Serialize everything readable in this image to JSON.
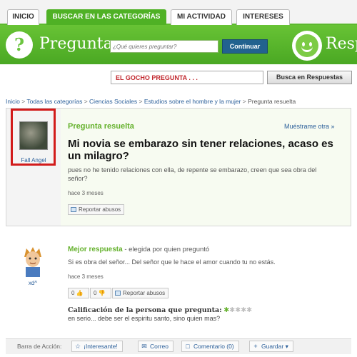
{
  "tabs": [
    "INICIO",
    "BUSCAR EN LAS CATEGORÍAS",
    "MI ACTIVIDAD",
    "INTERESES"
  ],
  "header": {
    "brand": "Pregunta",
    "brand_right": "Resp",
    "search_placeholder": "¿Qué quieres preguntar?",
    "continue_label": "Continuar"
  },
  "subsearch": {
    "value": "EL GOCHO PREGUNTA . . .",
    "button_label": "Busca en Respuestas"
  },
  "breadcrumb": [
    "Inicio",
    "Todas las categorías",
    "Ciencias Sociales",
    "Estudios sobre el hombre y la mujer"
  ],
  "breadcrumb_current": "Pregunta resuelta",
  "question": {
    "asker_name": "Fall Angel",
    "status": "Pregunta resuelta",
    "more_link": "Muéstrame otra »",
    "title": "Mi novia se embarazo sin tener relaciones, acaso es un milagro?",
    "body": "pues no he tenido relaciones con ella, de repente se embarazo, creen que sea obra del señor?",
    "time": "hace 3 meses",
    "report_label": "Reportar abusos"
  },
  "answer": {
    "answerer_name": "xd^",
    "best_label": "Mejor respuesta",
    "best_sub": " - elegida por quien preguntó",
    "body": "Si es obra del señor... Del señor que le hace el amor cuando tu no estás.",
    "time": "hace 3 meses",
    "thumbs_up": "0",
    "thumbs_down": "0",
    "report_label": "Reportar abusos",
    "rating_label": "Calificación de la persona que pregunta:",
    "rating_stars": 1,
    "rating_max": 5,
    "rating_comment": "en serio... debe ser el espiritu santo, sino quien mas?"
  },
  "action_bar": {
    "label": "Barra de Acción:",
    "interesting": "¡Interesante!",
    "email": "Correo",
    "comment": "Comentario (0)",
    "save": "Guardar"
  },
  "colors": {
    "brand_green": "#4fb125",
    "highlight_red": "#d21b1b",
    "link_blue": "#2b5f9a"
  }
}
